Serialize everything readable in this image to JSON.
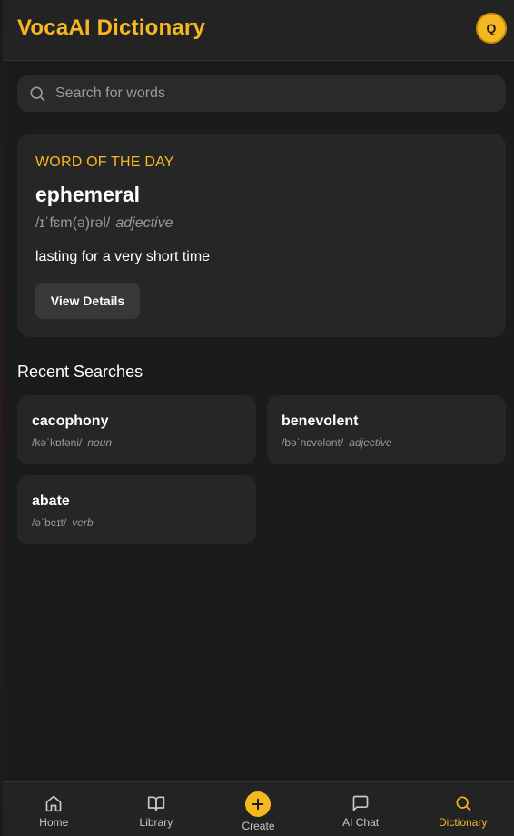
{
  "header": {
    "title": "VocaAI Dictionary",
    "avatar_initial": "Q"
  },
  "search": {
    "placeholder": "Search for words",
    "value": ""
  },
  "word_of_the_day": {
    "label": "WORD OF THE DAY",
    "word": "ephemeral",
    "pronunciation": "/ɪˈfɛm(ə)rəl/",
    "part_of_speech": "adjective",
    "definition": "lasting for a very short time",
    "button_label": "View Details"
  },
  "recent": {
    "title": "Recent Searches",
    "items": [
      {
        "word": "cacophony",
        "pronunciation": "/kəˈkɒfəni/",
        "part_of_speech": "noun"
      },
      {
        "word": "benevolent",
        "pronunciation": "/bəˈnɛvələnt/",
        "part_of_speech": "adjective"
      },
      {
        "word": "abate",
        "pronunciation": "/əˈbeɪt/",
        "part_of_speech": "verb"
      }
    ]
  },
  "nav": {
    "items": [
      {
        "label": "Home",
        "icon": "home-icon"
      },
      {
        "label": "Library",
        "icon": "book-icon"
      },
      {
        "label": "Create",
        "icon": "plus-icon"
      },
      {
        "label": "AI Chat",
        "icon": "chat-icon"
      },
      {
        "label": "Dictionary",
        "icon": "search-icon",
        "active": true
      }
    ]
  },
  "colors": {
    "accent": "#f5b820",
    "background": "#1b1b1b",
    "surface": "#262626",
    "muted_text": "#9a9a9a"
  }
}
